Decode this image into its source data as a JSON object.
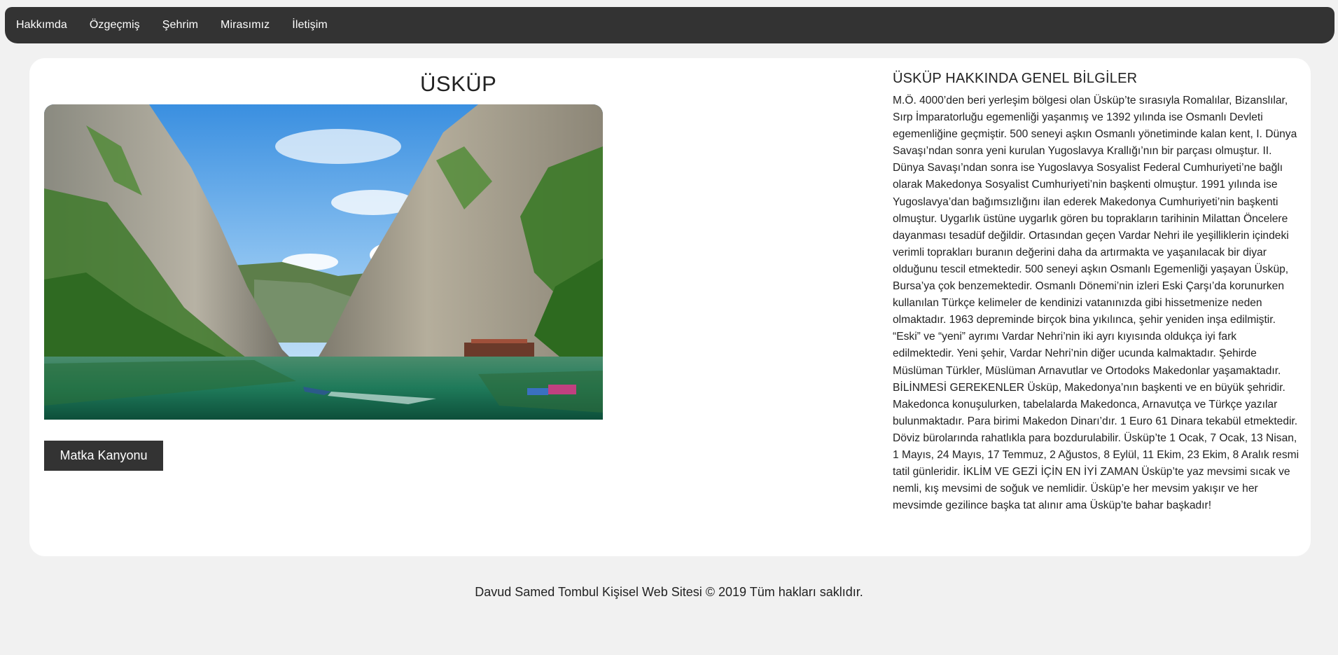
{
  "nav": {
    "items": [
      {
        "label": "Hakkımda"
      },
      {
        "label": "Özgeçmiş"
      },
      {
        "label": "Şehrim"
      },
      {
        "label": "Mirasımız"
      },
      {
        "label": "İletişim"
      }
    ]
  },
  "city": {
    "title": "ÜSKÜP",
    "button_label": "Matka Kanyonu"
  },
  "info": {
    "heading": "ÜSKÜP HAKKINDA GENEL BİLGİLER",
    "text": "M.Ö. 4000’den beri yerleşim bölgesi olan Üsküp’te sırasıyla Romalılar, Bizanslılar, Sırp İmparatorluğu egemenliği yaşanmış ve 1392 yılında ise Osmanlı Devleti egemenliğine geçmiştir. 500 seneyi aşkın Osmanlı yönetiminde kalan kent, I. Dünya Savaşı’ndan sonra yeni kurulan Yugoslavya Krallığı’nın bir parçası olmuştur. II. Dünya Savaşı’ndan sonra ise Yugoslavya Sosyalist Federal Cumhuriyeti’ne bağlı olarak Makedonya Sosyalist Cumhuriyeti’nin başkenti olmuştur. 1991 yılında ise Yugoslavya’dan bağımsızlığını ilan ederek Makedonya Cumhuriyeti’nin başkenti olmuştur. Uygarlık üstüne uygarlık gören bu toprakların tarihinin Milattan Öncelere dayanması tesadüf değildir. Ortasından geçen Vardar Nehri ile yeşilliklerin içindeki verimli toprakları buranın değerini daha da artırmakta ve yaşanılacak bir diyar olduğunu tescil etmektedir. 500 seneyi aşkın Osmanlı Egemenliği yaşayan Üsküp, Bursa’ya çok benzemektedir. Osmanlı Dönemi’nin izleri Eski Çarşı’da korunurken kullanılan Türkçe kelimeler de kendinizi vatanınızda gibi hissetmenize neden olmaktadır. 1963 depreminde birçok bina yıkılınca, şehir yeniden inşa edilmiştir. “Eski” ve “yeni” ayrımı Vardar Nehri’nin iki ayrı kıyısında oldukça iyi fark edilmektedir. Yeni şehir, Vardar Nehri’nin diğer ucunda kalmaktadır. Şehirde Müslüman Türkler, Müslüman Arnavutlar ve Ortodoks Makedonlar yaşamaktadır. BİLİNMESİ GEREKENLER Üsküp, Makedonya’nın başkenti ve en büyük şehridir. Makedonca konuşulurken, tabelalarda Makedonca, Arnavutça ve Türkçe yazılar bulunmaktadır. Para birimi Makedon Dinarı’dır. 1 Euro 61 Dinara tekabül etmektedir. Döviz bürolarında rahatlıkla para bozdurulabilir. Üsküp’te 1 Ocak, 7 Ocak, 13 Nisan, 1 Mayıs, 24 Mayıs, 17 Temmuz, 2 Ağustos, 8 Eylül, 11 Ekim, 23 Ekim, 8 Aralık resmi tatil günleridir. İKLİM VE GEZİ İÇİN EN İYİ ZAMAN Üsküp’te yaz mevsimi sıcak ve nemli, kış mevsimi de soğuk ve nemlidir. Üsküp’e her mevsim yakışır ve her mevsimde gezilince başka tat alınır ama Üsküp’te bahar başkadır!"
  },
  "footer": {
    "text": "Davud Samed Tombul Kişisel Web Sitesi © 2019 Tüm hakları saklıdır."
  },
  "colors": {
    "nav_background": "#333333",
    "page_background": "#f1f1f1",
    "card_background": "#ffffff",
    "button_background": "#333333"
  }
}
